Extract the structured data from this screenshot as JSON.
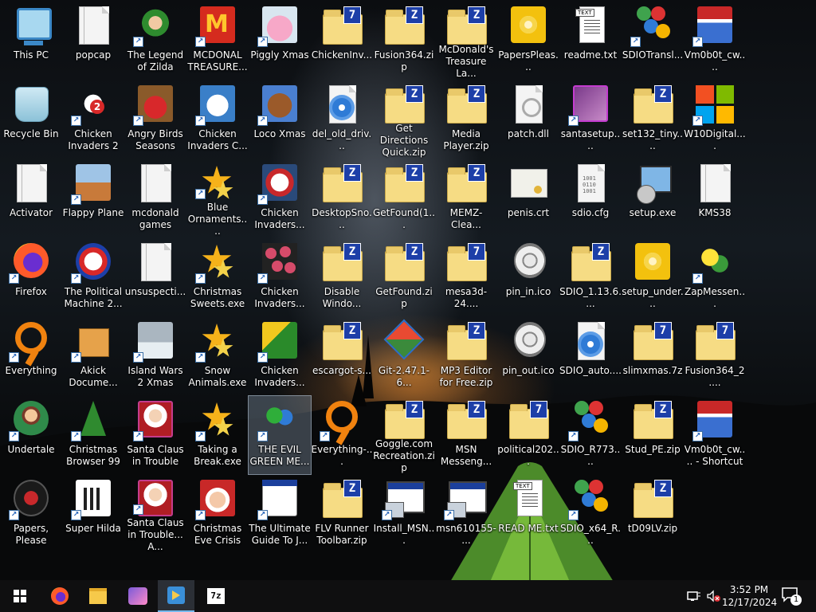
{
  "desktop": {
    "icons": [
      {
        "label": "This PC",
        "art": "pc"
      },
      {
        "label": "Recycle Bin",
        "art": "recycle"
      },
      {
        "label": "Activator",
        "art": "blank-folder"
      },
      {
        "label": "Firefox",
        "art": "firefox"
      },
      {
        "label": "Everything",
        "art": "magnifier"
      },
      {
        "label": "Undertale",
        "art": "undertale"
      },
      {
        "label": "Papers, Please",
        "art": "papers-please"
      },
      {
        "label": "popcap",
        "art": "blank-folder"
      },
      {
        "label": "Chicken Invaders 2",
        "art": "chicken"
      },
      {
        "label": "Flappy Plane",
        "art": "picture"
      },
      {
        "label": "The Political Machine 2...",
        "art": "politics"
      },
      {
        "label": "Akick Docume...",
        "art": "box"
      },
      {
        "label": "Christmas Browser 99",
        "art": "xmas-tree"
      },
      {
        "label": "Super Hilda",
        "art": "pixel-char"
      },
      {
        "label": "The Legend of Zilda",
        "art": "zelda"
      },
      {
        "label": "Angry Birds Seasons",
        "art": "angry-birds"
      },
      {
        "label": "mcdonald games",
        "art": "blank-folder"
      },
      {
        "label": "unsuspecti...",
        "art": "blank-folder"
      },
      {
        "label": "Island Wars 2 Xmas",
        "art": "island"
      },
      {
        "label": "Santa Claus in Trouble",
        "art": "santa"
      },
      {
        "label": "Santa Claus in Trouble... A...",
        "art": "santa"
      },
      {
        "label": "MCDONAL TREASURE...",
        "art": "mcdonalds"
      },
      {
        "label": "Chicken Invaders C...",
        "art": "snowman"
      },
      {
        "label": "Blue Ornaments....",
        "art": "stars"
      },
      {
        "label": "Christmas Sweets.exe",
        "art": "stars"
      },
      {
        "label": "Snow Animals.exe",
        "art": "stars"
      },
      {
        "label": "Taking a Break.exe",
        "art": "stars"
      },
      {
        "label": "Christmas Eve Crisis",
        "art": "santa-face"
      },
      {
        "label": "Piggly Xmas",
        "art": "pig"
      },
      {
        "label": "Loco Xmas",
        "art": "bear"
      },
      {
        "label": "Chicken Invaders...",
        "art": "chicken-xmas"
      },
      {
        "label": "Chicken Invaders...",
        "art": "balls"
      },
      {
        "label": "Chicken Invaders...",
        "art": "chicken-green"
      },
      {
        "label": "THE EVIL GREEN ME...",
        "art": "msn",
        "selected": true
      },
      {
        "label": "The Ultimate Guide To J...",
        "art": "window"
      },
      {
        "label": "ChickenInv...",
        "art": "zip7"
      },
      {
        "label": "del_old_driv...",
        "art": "gear"
      },
      {
        "label": "DesktopSno...",
        "art": "zip"
      },
      {
        "label": "Disable Windo...",
        "art": "zip"
      },
      {
        "label": "escargot-s...",
        "art": "zip"
      },
      {
        "label": "Everything-...",
        "art": "magnifier"
      },
      {
        "label": "FLV Runner Toolbar.zip",
        "art": "zip"
      },
      {
        "label": "Fusion364.zip",
        "art": "zip"
      },
      {
        "label": "Get Directions Quick.zip",
        "art": "zip"
      },
      {
        "label": "GetFound(1...",
        "art": "zip"
      },
      {
        "label": "GetFound.zip",
        "art": "zip"
      },
      {
        "label": "Git-2.47.1-6...",
        "art": "git"
      },
      {
        "label": "Goggle.com Recreation.zip",
        "art": "zip"
      },
      {
        "label": "Install_MSN...",
        "art": "installer"
      },
      {
        "label": "McDonald's Treasure La...",
        "art": "zip"
      },
      {
        "label": "Media Player.zip",
        "art": "zip"
      },
      {
        "label": "MEMZ-Clea...",
        "art": "zip"
      },
      {
        "label": "mesa3d-24....",
        "art": "zip7"
      },
      {
        "label": "MP3 Editor for Free.zip",
        "art": "zip"
      },
      {
        "label": "MSN Messeng...",
        "art": "zip"
      },
      {
        "label": "msn610155-...",
        "art": "installer"
      },
      {
        "label": "PapersPleas...",
        "art": "disc"
      },
      {
        "label": "patch.dll",
        "art": "dll"
      },
      {
        "label": "penis.crt",
        "art": "cert"
      },
      {
        "label": "pin_in.ico",
        "art": "ring"
      },
      {
        "label": "pin_out.ico",
        "art": "ring"
      },
      {
        "label": "political202...",
        "art": "zip7"
      },
      {
        "label": "READ ME.txt",
        "art": "text"
      },
      {
        "label": "readme.txt",
        "art": "text"
      },
      {
        "label": "santasetup....",
        "art": "santa-box"
      },
      {
        "label": "sdio.cfg",
        "art": "cfg"
      },
      {
        "label": "SDIO_1.13.6....",
        "art": "zip"
      },
      {
        "label": "SDIO_auto....",
        "art": "gear"
      },
      {
        "label": "SDIO_R773....",
        "art": "sdio"
      },
      {
        "label": "SDIO_x64_R...",
        "art": "sdio"
      },
      {
        "label": "SDIOTransl...",
        "art": "sdio"
      },
      {
        "label": "set132_tiny....",
        "art": "zip"
      },
      {
        "label": "setup.exe",
        "art": "setup"
      },
      {
        "label": "setup_under...",
        "art": "disc"
      },
      {
        "label": "slimxmas.7z",
        "art": "zip7"
      },
      {
        "label": "Stud_PE.zip",
        "art": "zip"
      },
      {
        "label": "tD09LV.zip",
        "art": "zip"
      },
      {
        "label": "Vm0b0t_cw....",
        "art": "santa-hat"
      },
      {
        "label": "W10Digital....",
        "art": "windows"
      },
      {
        "label": "KMS38",
        "art": "blank-folder"
      },
      {
        "label": "ZapMessen...",
        "art": "zap"
      },
      {
        "label": "Fusion364_2....",
        "art": "zip7"
      },
      {
        "label": "Vm0b0t_cw.... - Shortcut",
        "art": "santa-hat"
      }
    ]
  },
  "taskbar": {
    "apps": [
      {
        "name": "start-button"
      },
      {
        "name": "firefox-taskbar-icon"
      },
      {
        "name": "file-explorer-taskbar-icon"
      },
      {
        "name": "piggly-xmas-taskbar-icon"
      },
      {
        "name": "media-player-taskbar-icon",
        "active": true
      },
      {
        "name": "7zip-taskbar-icon",
        "text": "7z"
      }
    ],
    "time": "3:52 PM",
    "date": "12/17/2024",
    "notification_count": "1"
  },
  "colors": {
    "taskbar": "#0f0f10",
    "accent": "#76b9ed",
    "zip_badge": "#1d3fa8",
    "folder": "#f6dc84"
  }
}
